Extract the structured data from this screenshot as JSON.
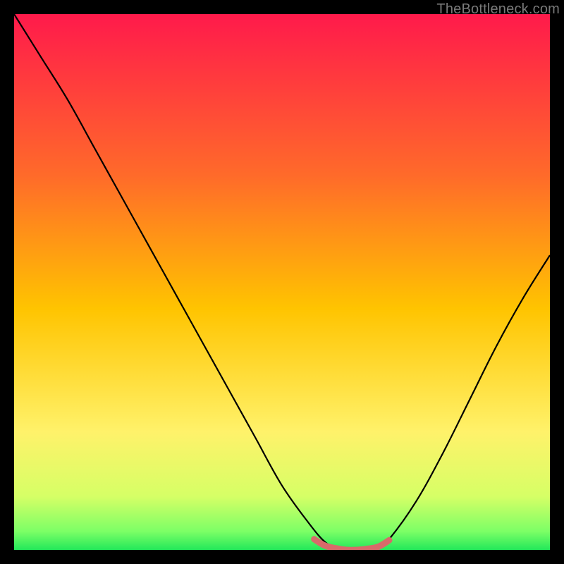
{
  "watermark": "TheBottleneck.com",
  "colors": {
    "frame": "#000000",
    "grad_top": "#ff1a4b",
    "grad_mid1": "#ff7a1f",
    "grad_mid2": "#ffd400",
    "grad_mid3": "#fff56b",
    "grad_bottom": "#2bff5e",
    "curve": "#000000",
    "flat_segment": "#d86a6a"
  },
  "chart_data": {
    "type": "line",
    "title": "",
    "xlabel": "",
    "ylabel": "",
    "xlim": [
      0,
      100
    ],
    "ylim": [
      0,
      100
    ],
    "series": [
      {
        "name": "curve",
        "x": [
          0,
          5,
          10,
          15,
          20,
          25,
          30,
          35,
          40,
          45,
          50,
          55,
          58,
          60,
          62,
          64,
          66,
          68,
          70,
          75,
          80,
          85,
          90,
          95,
          100
        ],
        "y": [
          100,
          92,
          84,
          75,
          66,
          57,
          48,
          39,
          30,
          21,
          12,
          5,
          1.5,
          0.5,
          0,
          0,
          0,
          0.5,
          2,
          9,
          18,
          28,
          38,
          47,
          55
        ]
      },
      {
        "name": "flat-bottom-highlight",
        "x": [
          56,
          58,
          60,
          62,
          64,
          66,
          68,
          70
        ],
        "y": [
          2,
          0.8,
          0.3,
          0,
          0,
          0.2,
          0.6,
          1.8
        ]
      }
    ],
    "gradient_stops": [
      {
        "offset": 0.0,
        "color": "#ff1a4b"
      },
      {
        "offset": 0.3,
        "color": "#ff6a2a"
      },
      {
        "offset": 0.55,
        "color": "#ffc400"
      },
      {
        "offset": 0.78,
        "color": "#fff26a"
      },
      {
        "offset": 0.9,
        "color": "#d6ff66"
      },
      {
        "offset": 0.965,
        "color": "#7dff66"
      },
      {
        "offset": 1.0,
        "color": "#23e85a"
      }
    ]
  }
}
